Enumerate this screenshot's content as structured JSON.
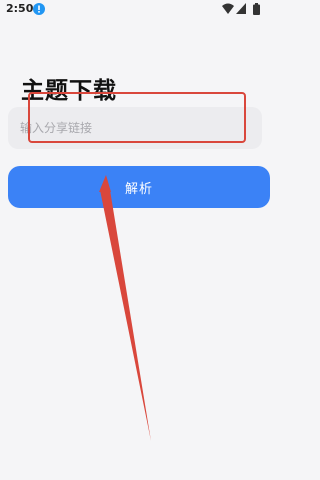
{
  "status_bar": {
    "time": "2:50",
    "icons": [
      "notification-icon",
      "wifi-icon",
      "signal-icon",
      "battery-icon"
    ]
  },
  "page": {
    "title": "主题下载"
  },
  "link_input": {
    "placeholder": "输入分享链接",
    "value": ""
  },
  "parse_button": {
    "label": "解析"
  },
  "colors": {
    "background": "#f5f5f7",
    "input_background": "#ececef",
    "button_accent": "#3b82f6",
    "annotation": "#d9473c"
  }
}
